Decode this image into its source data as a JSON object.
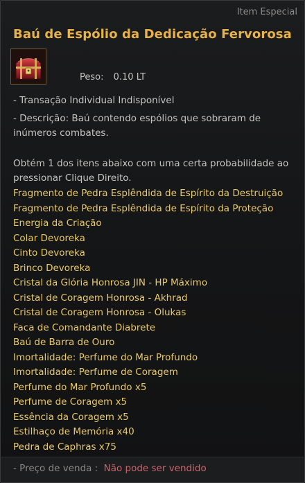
{
  "tooltip": {
    "category": "Item Especial",
    "title": "Baú de Espólio da Dedicação Fervorosa",
    "icon": "treasure-chest-icon",
    "weight_label": "Peso:",
    "weight_value": "0.10 LT",
    "trade_info": "- Transação Individual Indisponível",
    "description": "- Descrição: Baú contendo espólios que sobraram de inúmeros combates.",
    "usage": "Obtém 1 dos itens abaixo com uma certa probabilidade ao pressionar Clique Direito.",
    "items": [
      "Fragmento de Pedra Esplêndida de Espírito da Destruição",
      "Fragmento de Pedra Esplêndida de Espírito da Proteção",
      "Energia da Criação",
      "Colar Devoreka",
      "Cinto Devoreka",
      "Brinco Devoreka",
      "Cristal da Glória Honrosa JIN - HP Máximo",
      "Cristal de Coragem Honrosa - Akhrad",
      "Cristal de Coragem Honrosa - Olukas",
      "Faca de Comandante Diabrete",
      "Baú de Barra de Ouro",
      "Imortalidade: Perfume do Mar Profundo",
      "Imortalidade: Perfume de Coragem",
      "Perfume do Mar Profundo x5",
      "Perfume de Coragem x5",
      "Essência da Coragem x5",
      "Estilhaço de Memória x40",
      "Pedra de Caphras x75"
    ],
    "sell_label": "- Preço de venda :",
    "sell_value": "Não pode ser vendido",
    "colors": {
      "title": "#e8b24a",
      "item_text": "#e9c96a",
      "body_text": "#c7c4c0",
      "sell_value": "#c8646b"
    }
  }
}
